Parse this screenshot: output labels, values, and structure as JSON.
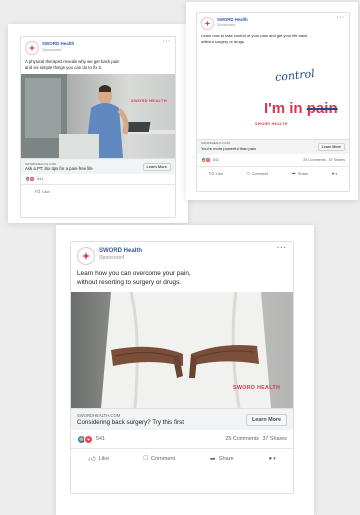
{
  "brand": {
    "name": "SWORD Health",
    "sponsored": "Sponsored",
    "domain": "SWORDHEALTH.COM",
    "photo_watermark": "SWORD HEALTH",
    "accent": "#d8384f",
    "link_blue": "#385898"
  },
  "post1": {
    "text_line1": "A physical therapist reveals why we get back pain",
    "text_line2": "and six simple things you can do to fix it.",
    "headline": "Ask a PT: Six tips for a pain-free life",
    "cta": "Learn More",
    "count": "541",
    "like": "Like"
  },
  "post2": {
    "text_line1": "Learn how to take control of your pain and get your life back,",
    "text_line2": "without surgery or drugs.",
    "art_control": "control",
    "art_im_in": "I'm in ",
    "art_pain": "pain",
    "headline": "You're more powerful than pain",
    "cta": "Learn More",
    "count": "541",
    "comments": "25 Comments",
    "shares": "37 Shares",
    "like": "Like",
    "comment": "Comment",
    "share": "Share"
  },
  "post3": {
    "text_line1": "Learn how you can overcome your pain,",
    "text_line2": "without resorting to surgery or drugs.",
    "headline": "Considering back surgery? Try this first",
    "cta": "Learn More",
    "count": "541",
    "comments": "25 Comments",
    "shares": "37 Shares",
    "like": "Like",
    "comment": "Comment",
    "share": "Share"
  }
}
